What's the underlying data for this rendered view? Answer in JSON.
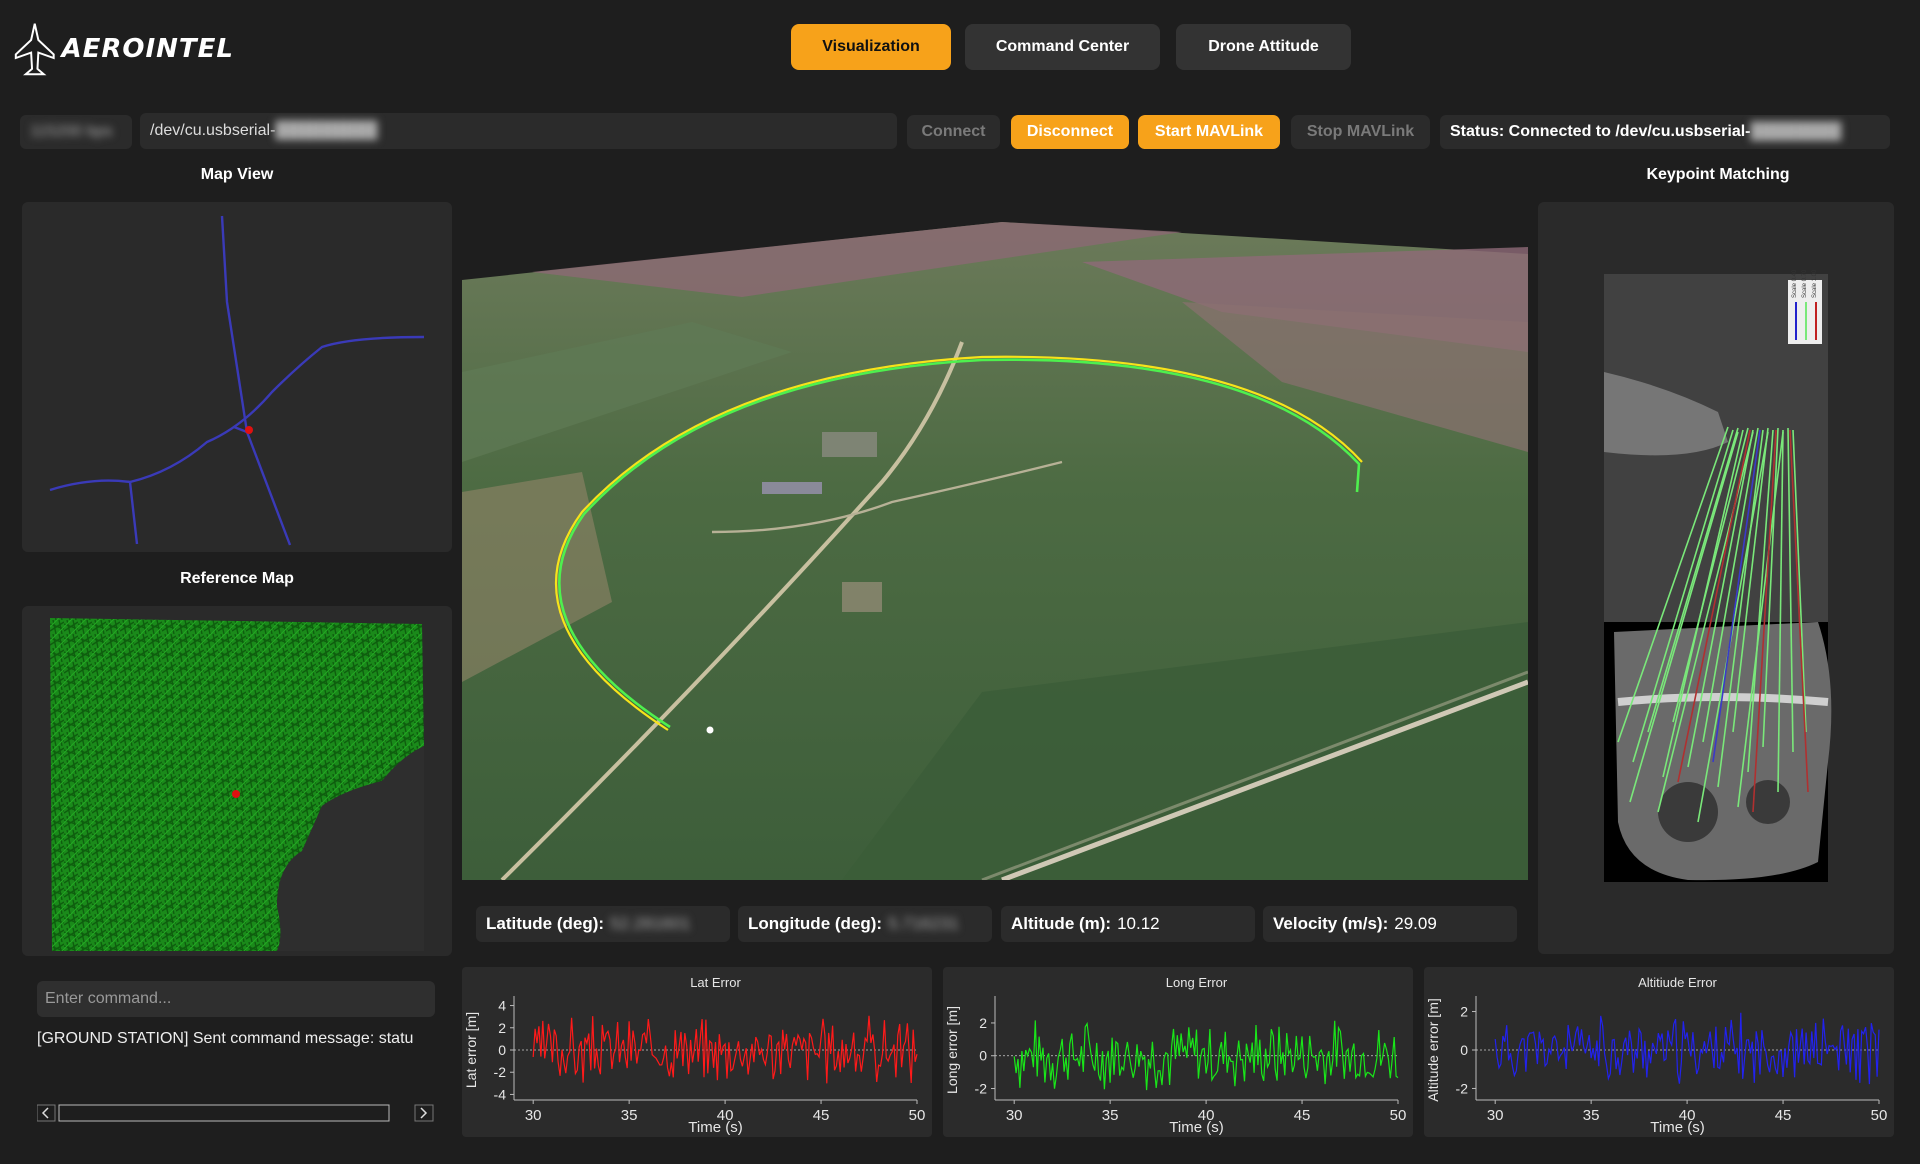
{
  "app": {
    "brand": "AEROINTEL"
  },
  "tabs": [
    {
      "label": "Visualization",
      "active": true
    },
    {
      "label": "Command Center",
      "active": false
    },
    {
      "label": "Drone Attitude",
      "active": false
    }
  ],
  "connection": {
    "baud": "115200 bps",
    "port": "/dev/cu.usbserial-",
    "connect_label": "Connect",
    "disconnect_label": "Disconnect",
    "start_label": "Start MAVLink",
    "stop_label": "Stop MAVLink",
    "status_text": "Status: Connected to /dev/cu.usbserial-"
  },
  "sections": {
    "map_view": "Map View",
    "reference_map": "Reference Map",
    "keypoint": "Keypoint Matching"
  },
  "keypoint_legend": [
    "Scale 0.40",
    "Scale 0.70",
    "Scale 1.00"
  ],
  "telemetry": {
    "lat_label": "Latitude (deg):",
    "lat_value": "52.281601",
    "lon_label": "Longitude (deg):",
    "lon_value": "5.716231",
    "alt_label": "Altitude (m):",
    "alt_value": "10.12",
    "vel_label": "Velocity (m/s):",
    "vel_value": "29.09"
  },
  "console": {
    "placeholder": "Enter command...",
    "log_line": "[GROUND STATION] Sent command message: statu"
  },
  "colors": {
    "accent": "#f7a21a",
    "lat_series": "#ff1a1a",
    "lon_series": "#19e619",
    "alt_series": "#2222ee"
  },
  "chart_data": [
    {
      "type": "line",
      "title": "Lat Error",
      "xlabel": "Time (s)",
      "ylabel": "Lat error [m]",
      "xlim": [
        29,
        50
      ],
      "ylim": [
        -4.5,
        4.5
      ],
      "xticks": [
        30,
        35,
        40,
        45,
        50
      ],
      "yticks": [
        4,
        2,
        0,
        -2,
        -4
      ],
      "series": [
        {
          "color": "#ff1a1a",
          "x_start": 30,
          "x_end": 50,
          "amplitude": 3.5,
          "seed": 3
        }
      ]
    },
    {
      "type": "line",
      "title": "Long Error",
      "xlabel": "Time (s)",
      "ylabel": "Long error [m]",
      "xlim": [
        29,
        50
      ],
      "ylim": [
        -2.7,
        3.4
      ],
      "xticks": [
        30,
        35,
        40,
        45,
        50
      ],
      "yticks": [
        2,
        0,
        -2
      ],
      "series": [
        {
          "color": "#19e619",
          "x_start": 30,
          "x_end": 50,
          "amplitude": 2.5,
          "seed": 7
        }
      ]
    },
    {
      "type": "line",
      "title": "Altitiude Error",
      "xlabel": "Time (s)",
      "ylabel": "Altitude error [m]",
      "xlim": [
        29,
        50
      ],
      "ylim": [
        -2.6,
        2.6
      ],
      "xticks": [
        30,
        35,
        40,
        45,
        50
      ],
      "yticks": [
        2,
        0,
        -2
      ],
      "series": [
        {
          "color": "#2222ee",
          "x_start": 30,
          "x_end": 50,
          "amplitude": 2.0,
          "seed": 11
        }
      ]
    }
  ]
}
